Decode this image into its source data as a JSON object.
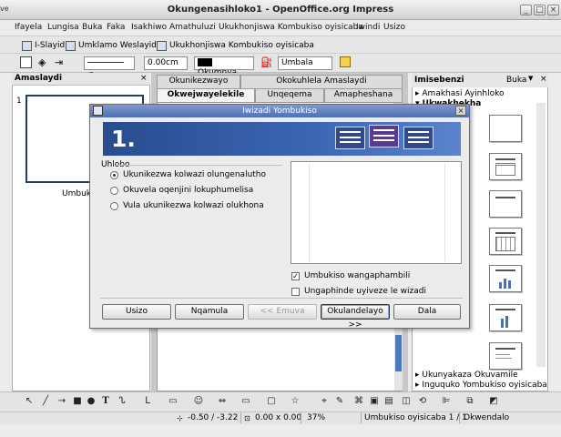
{
  "window": {
    "title": "Okungenasihloko1 - OpenOffice.org Impress",
    "left_edge_text": "ve"
  },
  "menubar": [
    "Ifayela",
    "Lungisa",
    "Buka",
    "Faka",
    "Isakhiwo",
    "Amathuluzi",
    "Ukukhonjiswa Kombukiso oyisicaba",
    "Iwindi",
    "Usizo"
  ],
  "toolbar1": {
    "slide_label": "I-Slayidi",
    "slide_design_label": "Umklamo Weslayidi",
    "presentation_label": "Ukukhonjiswa Kombukiso oyisicaba"
  },
  "toolbar2": {
    "line_width": "0.00cm",
    "color_name": "Okumnya",
    "area_style": "Umbala"
  },
  "left_panel": {
    "title": "Amaslaydi",
    "slide_number": "1",
    "slide_caption": "Umbukiso"
  },
  "tabs_row1": [
    "Okunikezwayo",
    "Okokuhlela Amaslaydi"
  ],
  "tabs_row2": [
    "Okwejwayelekile",
    "Unqeqema",
    "Amapheshana"
  ],
  "right_panel": {
    "title": "Imisebenzi",
    "view_menu": "Buka",
    "section_master": "Amakhasi Ayinhloko",
    "section_layouts": "Ukwakhekha",
    "section_animation": "Ukunyakaza Okuvamile",
    "section_transition": "Inguquko Yombukiso oyisicaba"
  },
  "status_bar": {
    "position": "-0.50 / -3.22",
    "size": "0.00 x 0.00",
    "zoom": "37%",
    "slide": "Umbukiso oyisicaba 1 / 1",
    "layout": "Okwendalo"
  },
  "dialog": {
    "title": "Iwizadi Yombukiso",
    "step": "1.",
    "group_label": "Uhlobo",
    "radios": [
      {
        "label": "Ukunikezwa kolwazi olungenalutho",
        "checked": true
      },
      {
        "label": "Okuvela oqenjini lokuphumelisa",
        "checked": false
      },
      {
        "label": "Vula ukunikezwa kolwazi olukhona",
        "checked": false
      }
    ],
    "checkboxes": [
      {
        "label": "Umbukiso wangaphambili",
        "checked": true
      },
      {
        "label": "Ungaphinde uyiveze le wizadi",
        "checked": false
      }
    ],
    "buttons": {
      "help": "Usizo",
      "cancel": "Nqamula",
      "back": "<< Emuva",
      "next": "Okulandelayo >>",
      "create": "Dala"
    }
  }
}
